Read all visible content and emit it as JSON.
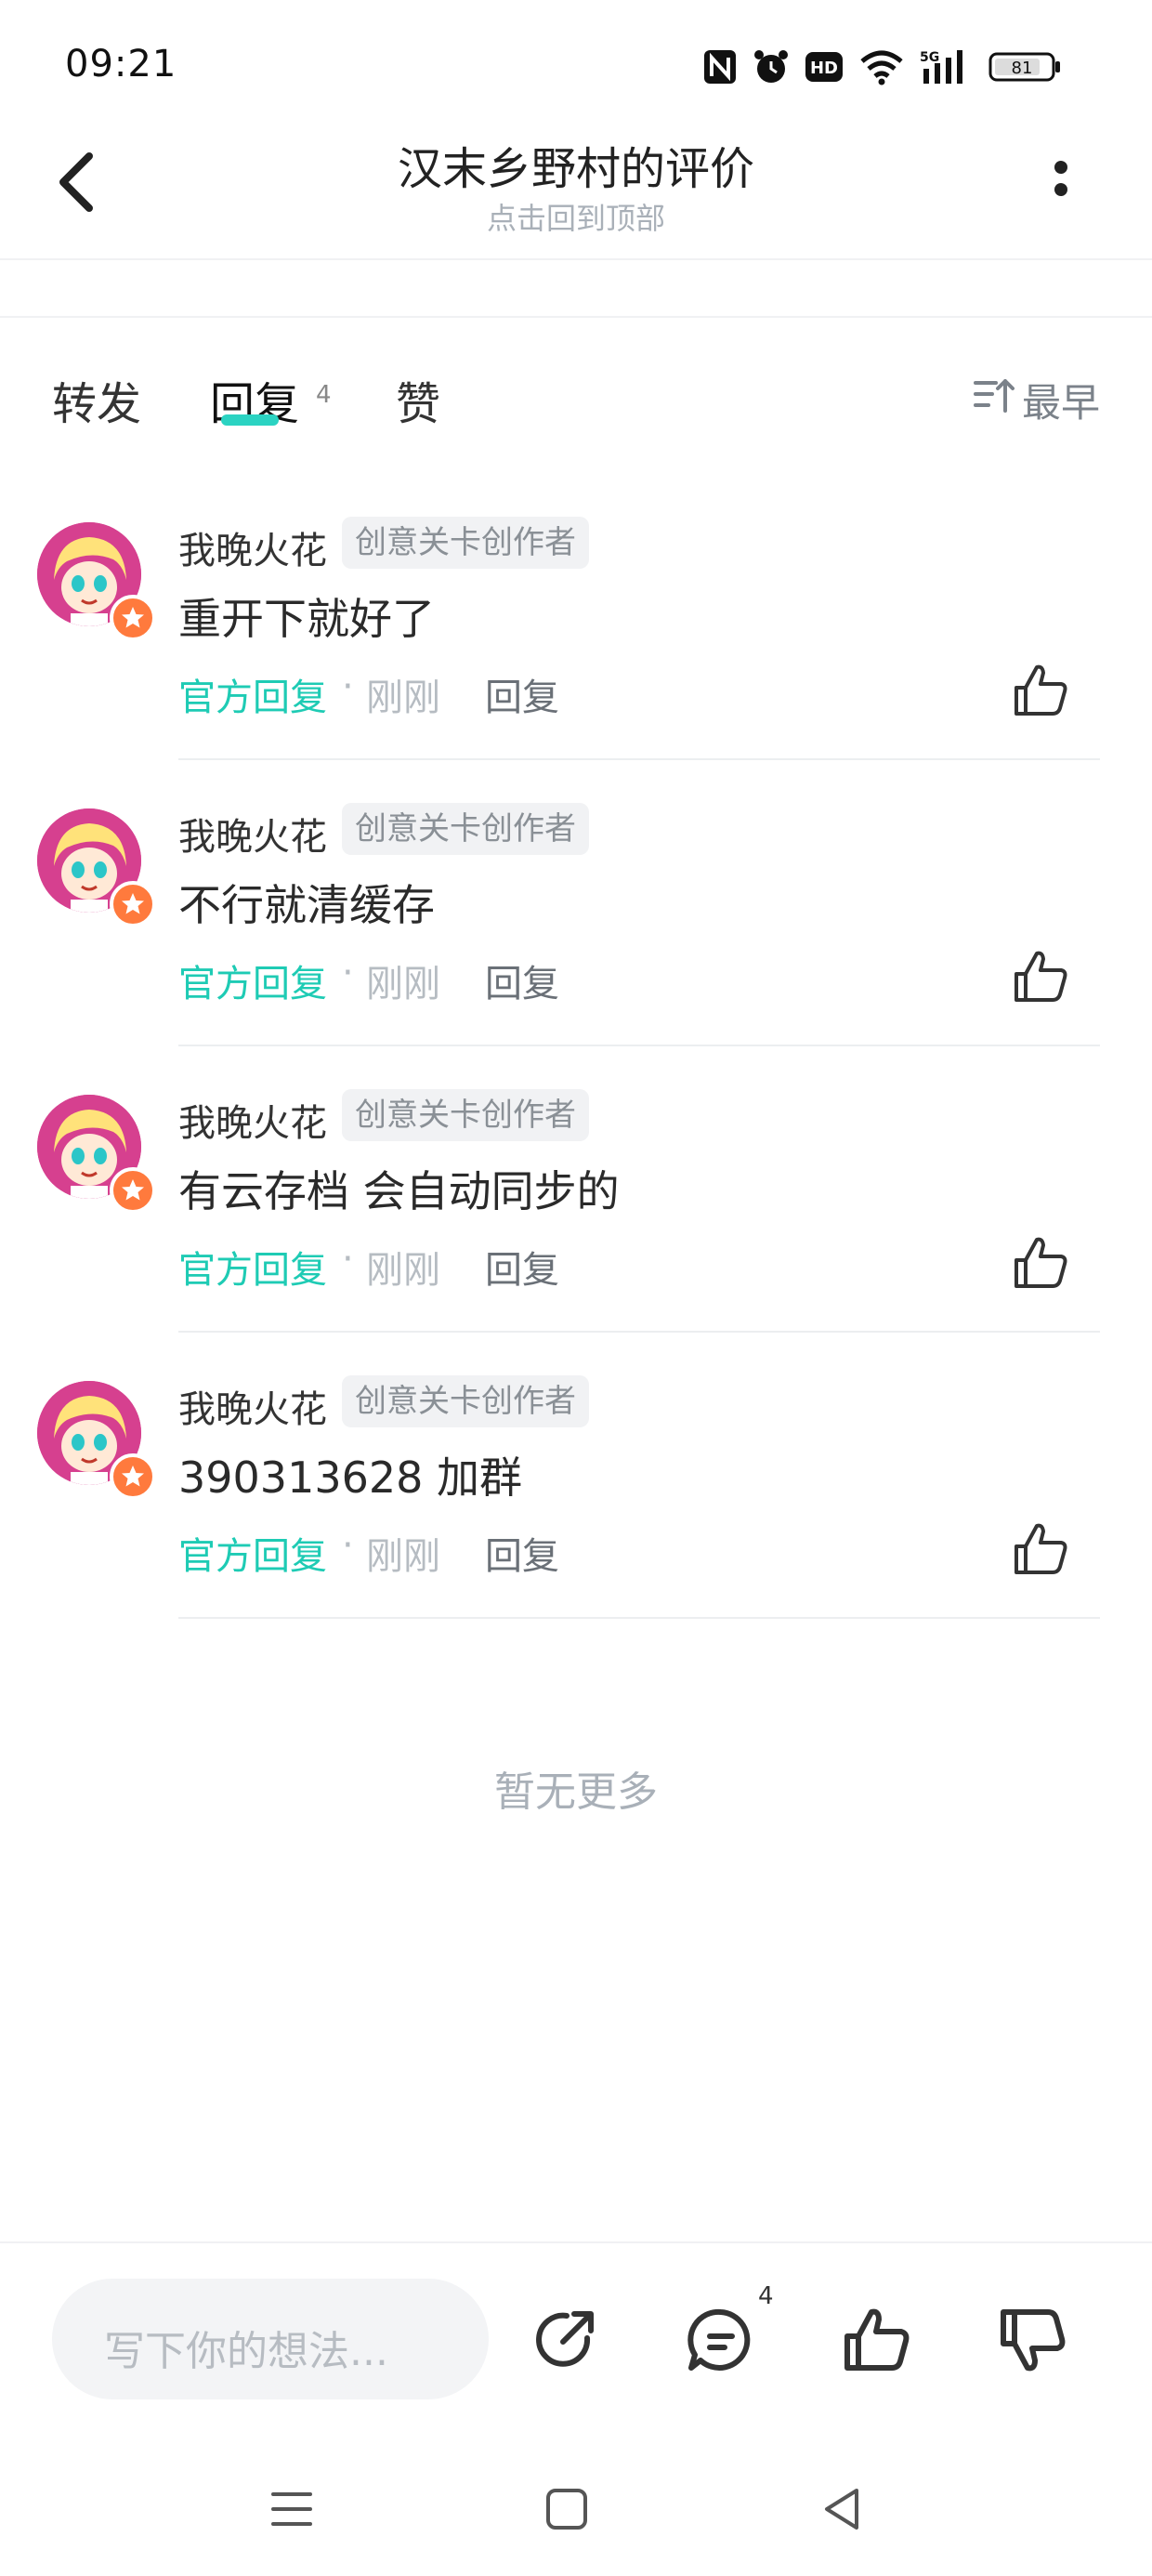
{
  "status_bar": {
    "time": "09:21",
    "icons": [
      "nfc-icon",
      "alarm-icon",
      "hd-icon",
      "wifi-icon",
      "5g-signal-icon",
      "battery-icon"
    ],
    "battery": "81"
  },
  "header": {
    "title": "汉末乡野村的评价",
    "subtitle": "点击回到顶部",
    "back_icon": "back-arrow-icon",
    "more_icon": "more-vertical-icon"
  },
  "tabs": {
    "forward": "转发",
    "reply": "回复",
    "reply_count": "4",
    "like": "赞",
    "sort_label": "最早",
    "accent": "#2bd3c2"
  },
  "comments": [
    {
      "name": "我晚火花",
      "tag": "创意关卡创作者",
      "content": "重开下就好了",
      "official": "官方回复",
      "time": "刚刚",
      "reply": "回复"
    },
    {
      "name": "我晚火花",
      "tag": "创意关卡创作者",
      "content": "不行就清缓存",
      "official": "官方回复",
      "time": "刚刚",
      "reply": "回复"
    },
    {
      "name": "我晚火花",
      "tag": "创意关卡创作者",
      "content": "有云存档 会自动同步的",
      "official": "官方回复",
      "time": "刚刚",
      "reply": "回复"
    },
    {
      "name": "我晚火花",
      "tag": "创意关卡创作者",
      "content": "390313628 加群",
      "official": "官方回复",
      "time": "刚刚",
      "reply": "回复"
    }
  ],
  "footer": {
    "no_more": "暂无更多"
  },
  "bottom_bar": {
    "input_placeholder": "写下你的想法...",
    "comment_count": "4",
    "icons": [
      "share-icon",
      "comment-icon",
      "thumbs-up-icon",
      "thumbs-down-icon"
    ]
  },
  "nav_bar": {
    "icons": [
      "menu-icon",
      "home-square-icon",
      "back-triangle-icon"
    ]
  }
}
